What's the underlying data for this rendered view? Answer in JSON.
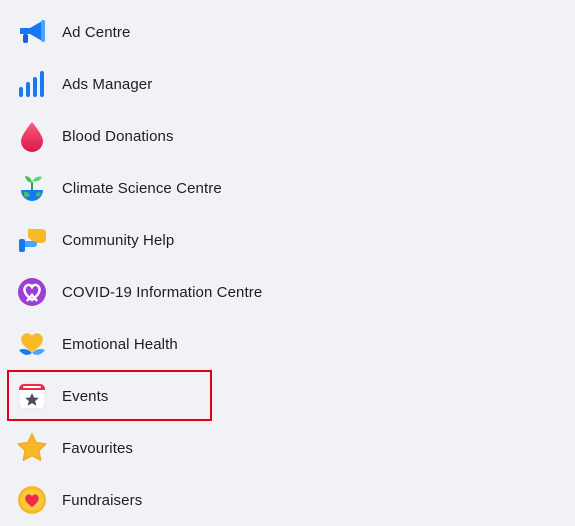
{
  "menu": {
    "items": [
      {
        "label": "Ad Centre",
        "icon": "megaphone-icon"
      },
      {
        "label": "Ads Manager",
        "icon": "bar-chart-icon"
      },
      {
        "label": "Blood Donations",
        "icon": "blood-drop-icon"
      },
      {
        "label": "Climate Science Centre",
        "icon": "globe-sprout-icon"
      },
      {
        "label": "Community Help",
        "icon": "helping-hand-icon"
      },
      {
        "label": "COVID-19 Information Centre",
        "icon": "heart-ribbon-icon"
      },
      {
        "label": "Emotional Health",
        "icon": "heart-flower-icon"
      },
      {
        "label": "Events",
        "icon": "calendar-star-icon"
      },
      {
        "label": "Favourites",
        "icon": "star-icon"
      },
      {
        "label": "Fundraisers",
        "icon": "heart-coin-icon"
      }
    ],
    "highlighted_item": "Events"
  },
  "colors": {
    "background": "#f0f2f5",
    "text": "#1c1e21",
    "highlight_border": "#e0001b",
    "blue": "#1877f2"
  }
}
